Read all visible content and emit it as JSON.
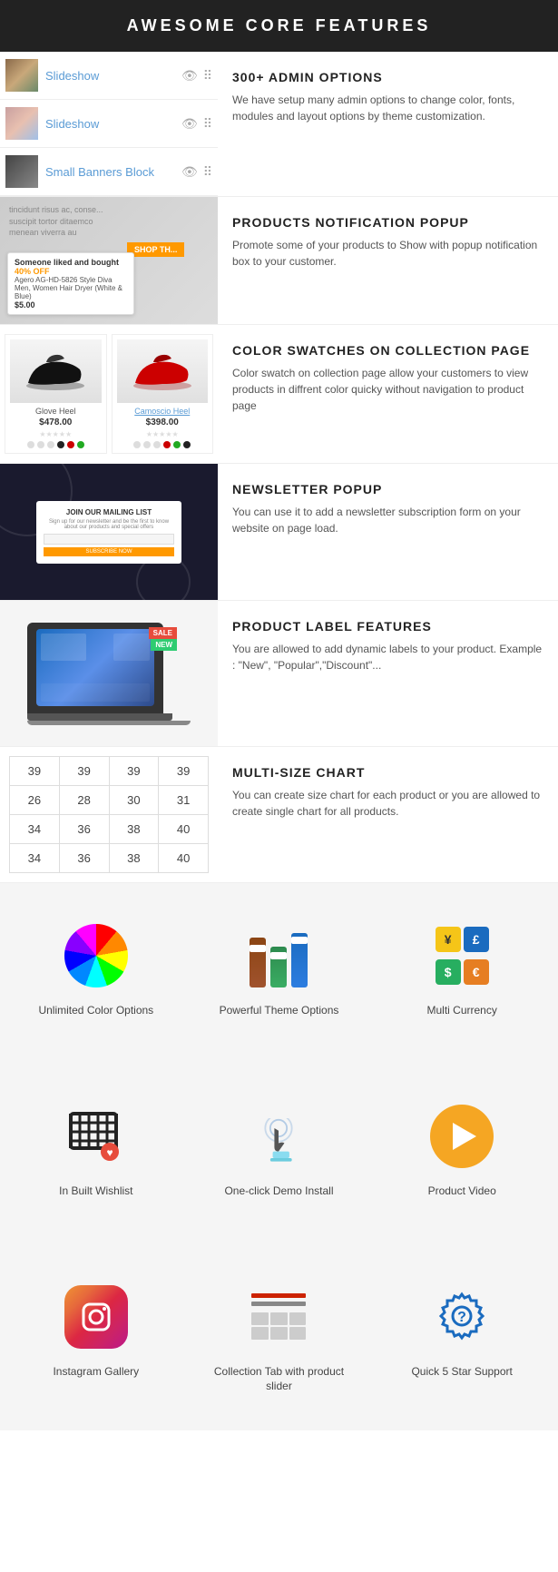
{
  "header": {
    "title": "AWESOME CORE FEATURES"
  },
  "admin": {
    "title": "300+ ADMIN OPTIONS",
    "desc": "We have setup many admin options to change color, fonts, modules and layout options by theme customization.",
    "rows": [
      {
        "label": "Slideshow",
        "thumbClass": "thumb1"
      },
      {
        "label": "Slideshow",
        "thumbClass": "thumb2"
      },
      {
        "label": "Small Banners Block",
        "thumbClass": "thumb3"
      }
    ]
  },
  "notification": {
    "title": "PRODUCTS NOTIFICATION POPUP",
    "desc": "Promote some of your products to Show with popup notification box to your customer.",
    "popup": {
      "text": "Someone liked and bought",
      "discount": "40% OFF",
      "product": "Agero AG-HD-5826 Style Diva Men, Women Hair Dryer (White & Blue)",
      "price": "$5.00"
    },
    "shop_btn": "SHOP TH..."
  },
  "swatches": {
    "title": "COLOR SWATCHES ON COLLECTION PAGE",
    "desc": "Color swatch on collection page allow your customers to view products in diffrent color quicky without navigation to product page",
    "products": [
      {
        "name": "Glove Heel",
        "price": "$478.00",
        "color": "black",
        "dots": [
          "#ddd",
          "#ddd",
          "#ddd",
          "#ddd",
          "#ddd",
          "#222",
          "#c00",
          "#2a2"
        ]
      },
      {
        "name": "Camoscio Heel",
        "price": "$398.00",
        "color": "red",
        "dots": [
          "#ddd",
          "#ddd",
          "#ddd",
          "#ddd",
          "#ddd",
          "#c00",
          "#2a2",
          "#222"
        ]
      }
    ]
  },
  "newsletter": {
    "title": "NEWSLETTER POPUP",
    "desc": "You can use it to add a newsletter subscription form on your website on page load.",
    "inner_title": "JOIN OUR MAILING LIST",
    "inner_desc": "Sign up for our newsletter and be the first to know about our products and special offers",
    "btn_label": "SUBSCRIBE NOW"
  },
  "product_label": {
    "title": "PRODUCT LABEL FEATURES",
    "desc": "You are allowed to add dynamic labels to your product. Example : \"New\", \"Popular\",\"Discount\"...",
    "badges": [
      "SALE",
      "NEW"
    ]
  },
  "size_chart": {
    "title": "MULTI-SIZE CHART",
    "desc": "You can create size chart for each product or you are allowed to create single chart for all products.",
    "rows": [
      [
        39,
        39,
        39,
        39
      ],
      [
        26,
        28,
        30,
        31
      ],
      [
        34,
        36,
        38,
        40
      ],
      [
        34,
        36,
        38,
        40
      ]
    ]
  },
  "features_grid": {
    "items": [
      {
        "key": "color-options",
        "label": "Unlimited Color Options",
        "icon": "color-wheel"
      },
      {
        "key": "theme-options",
        "label": "Powerful Theme Options",
        "icon": "theme-toggles"
      },
      {
        "key": "multi-currency",
        "label": "Multi Currency",
        "icon": "currency"
      },
      {
        "key": "wishlist",
        "label": "In Built Wishlist",
        "icon": "wishlist"
      },
      {
        "key": "demo-install",
        "label": "One-click Demo Install",
        "icon": "demo"
      },
      {
        "key": "product-video",
        "label": "Product Video",
        "icon": "video"
      },
      {
        "key": "instagram",
        "label": "Instagram Gallery",
        "icon": "instagram"
      },
      {
        "key": "collection-tab",
        "label": "Collection Tab with product slider",
        "icon": "collection"
      },
      {
        "key": "support",
        "label": "Quick 5 Star Support",
        "icon": "support"
      }
    ]
  }
}
